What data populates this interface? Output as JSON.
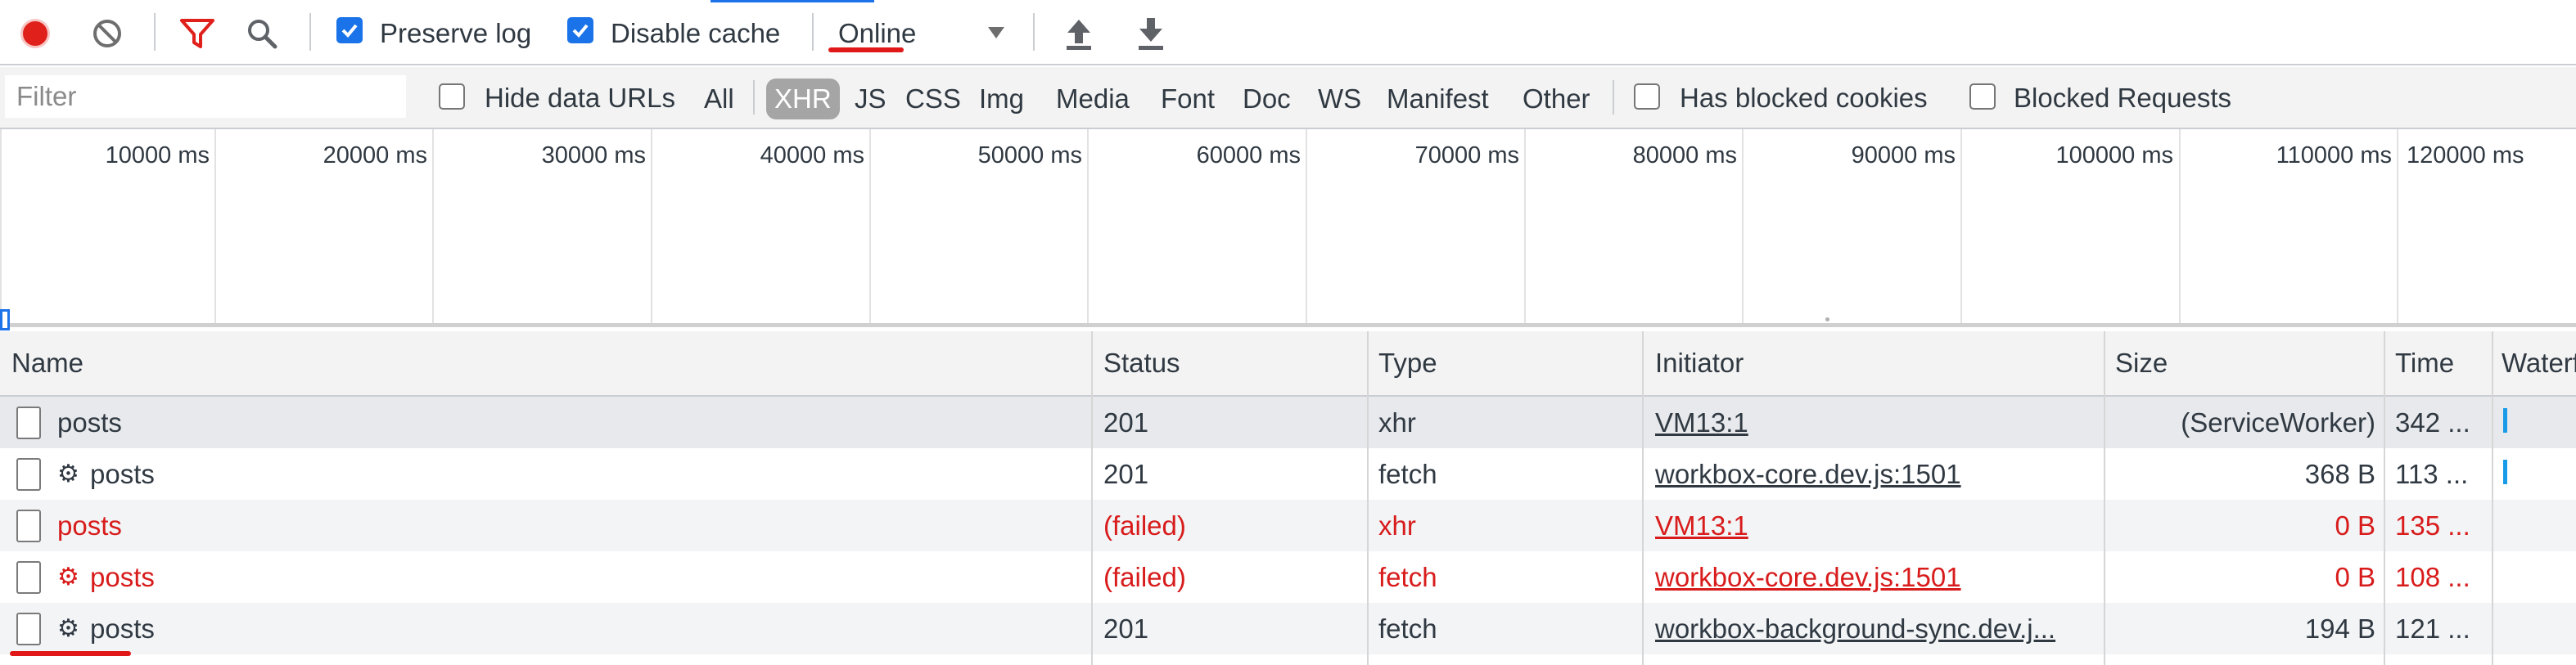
{
  "toolbar": {
    "record_label": "Record",
    "clear_label": "Clear",
    "preserve_log_label": "Preserve log",
    "preserve_log_checked": true,
    "disable_cache_label": "Disable cache",
    "disable_cache_checked": true,
    "throttling_value": "Online"
  },
  "filter_bar": {
    "filter_placeholder": "Filter",
    "hide_data_urls_label": "Hide data URLs",
    "types": [
      "All",
      "XHR",
      "JS",
      "CSS",
      "Img",
      "Media",
      "Font",
      "Doc",
      "WS",
      "Manifest",
      "Other"
    ],
    "active_type": "XHR",
    "has_blocked_cookies_label": "Has blocked cookies",
    "blocked_requests_label": "Blocked Requests"
  },
  "overview": {
    "ticks": [
      "10000 ms",
      "20000 ms",
      "30000 ms",
      "40000 ms",
      "50000 ms",
      "60000 ms",
      "70000 ms",
      "80000 ms",
      "90000 ms",
      "100000 ms",
      "110000 ms",
      "120000 ms"
    ]
  },
  "table": {
    "columns": [
      "Name",
      "Status",
      "Type",
      "Initiator",
      "Size",
      "Time",
      "Waterfall"
    ],
    "rows": [
      {
        "name": "posts",
        "gear": false,
        "status": "201",
        "type": "xhr",
        "initiator": "VM13:1",
        "size": "(ServiceWorker)",
        "time": "342 ...",
        "failed": false
      },
      {
        "name": "posts",
        "gear": true,
        "status": "201",
        "type": "fetch",
        "initiator": "workbox-core.dev.js:1501",
        "size": "368 B",
        "time": "113 ...",
        "failed": false
      },
      {
        "name": "posts",
        "gear": false,
        "status": "(failed)",
        "type": "xhr",
        "initiator": "VM13:1",
        "size": "0 B",
        "time": "135 ...",
        "failed": true
      },
      {
        "name": "posts",
        "gear": true,
        "status": "(failed)",
        "type": "fetch",
        "initiator": "workbox-core.dev.js:1501",
        "size": "0 B",
        "time": "108 ...",
        "failed": true
      },
      {
        "name": "posts",
        "gear": true,
        "status": "201",
        "type": "fetch",
        "initiator": "workbox-background-sync.dev.j...",
        "size": "194 B",
        "time": "121 ...",
        "failed": false
      }
    ]
  },
  "colors": {
    "record_red": "#e0201b",
    "accent_blue": "#1a73e8",
    "failed_red": "#d81b1b",
    "annotation_red": "#e01818"
  }
}
